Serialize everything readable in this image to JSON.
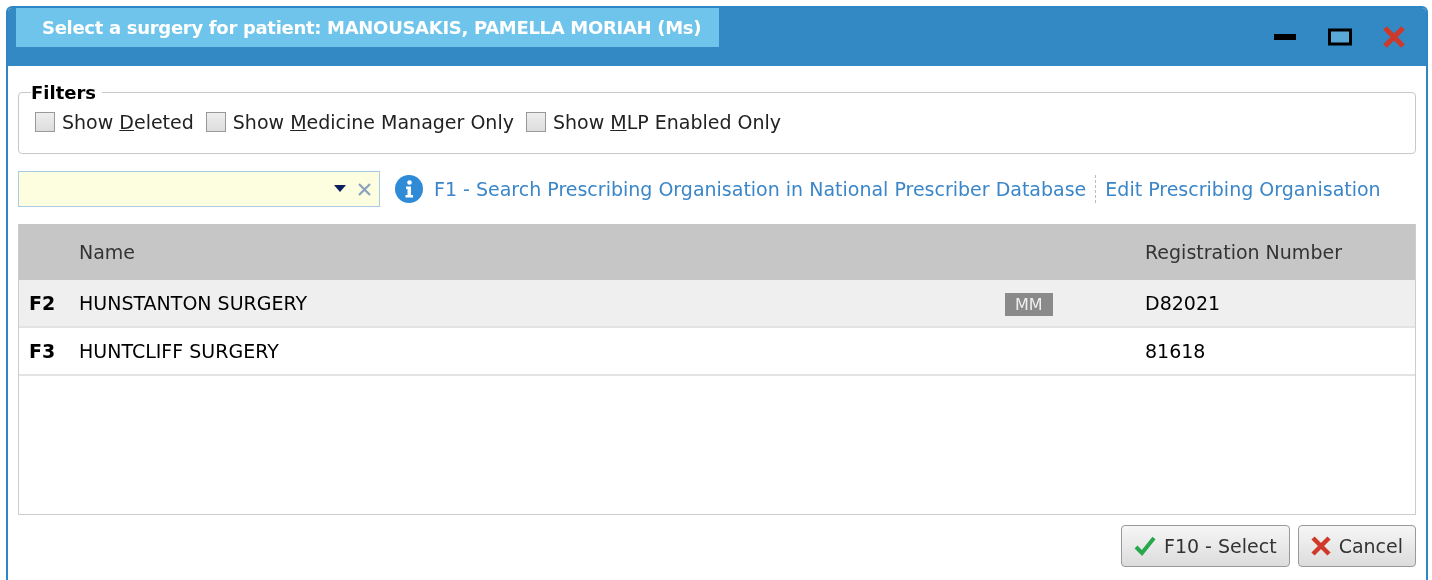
{
  "window": {
    "title": "Select a surgery for patient: MANOUSAKIS, PAMELLA MORIAH (Ms)"
  },
  "filters": {
    "title": "Filters",
    "options": [
      {
        "before": "Show ",
        "key": "D",
        "after": "eleted",
        "checked": false
      },
      {
        "before": "Show ",
        "key": "M",
        "after": "edicine Manager Only",
        "checked": false
      },
      {
        "before": "Show ",
        "key": "M",
        "after": "LP Enabled Only",
        "checked": false
      }
    ]
  },
  "links": [
    "F1 - Search Prescribing Organisation in National Prescriber Database",
    "Edit Prescribing Organisation"
  ],
  "table": {
    "columns": [
      "Name",
      "Registration Number"
    ],
    "rows": [
      {
        "key": "F2",
        "name": "HUNSTANTON SURGERY",
        "badge": "MM",
        "registration": "D82021",
        "selected": true
      },
      {
        "key": "F3",
        "name": "HUNTCLIFF SURGERY",
        "registration": "81618",
        "selected": false
      }
    ]
  },
  "buttons": [
    {
      "kind": "ok",
      "label": "F10 - Select"
    },
    {
      "kind": "cancel",
      "label": "Cancel"
    }
  ]
}
